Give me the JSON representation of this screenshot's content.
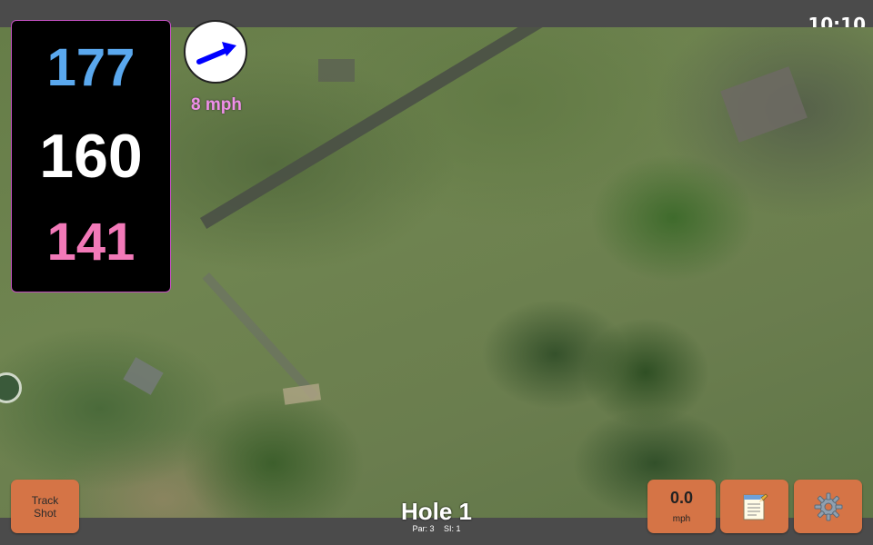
{
  "status": {
    "time": "10:10"
  },
  "distances": {
    "back": "177",
    "middle": "160",
    "front": "141"
  },
  "wind": {
    "speed": "8 mph",
    "direction_icon": "arrow-icon",
    "arrow_color": "#0000ff"
  },
  "buttons": {
    "track_shot": {
      "line1": "Track",
      "line2": "Shot"
    },
    "speed": {
      "value": "0.0",
      "unit": "mph"
    },
    "notes_icon": "notepad-icon",
    "settings_icon": "gear-icon"
  },
  "hole": {
    "title": "Hole 1",
    "par": "Par: 3",
    "si": "SI: 1"
  },
  "colors": {
    "back": "#5aa8ee",
    "middle": "#ffffff",
    "front": "#f279b8",
    "wind_text": "#ef8fe8",
    "button": "#d57446"
  }
}
